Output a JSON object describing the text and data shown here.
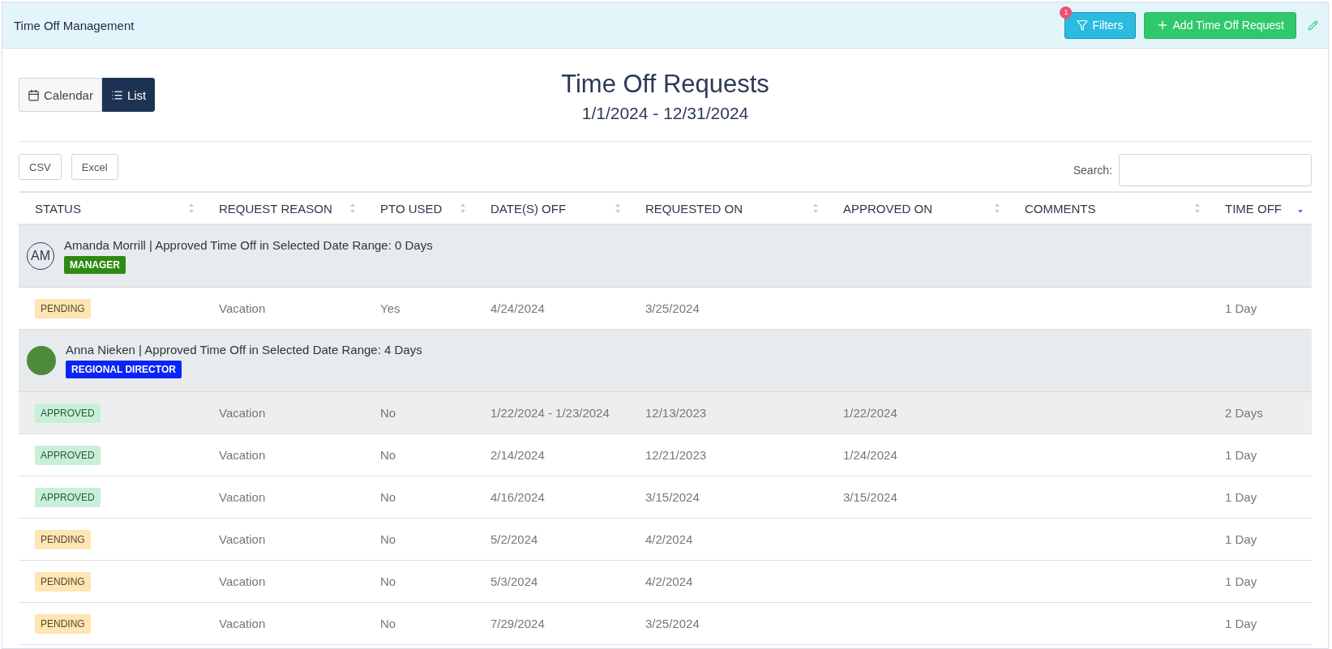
{
  "header": {
    "title": "Time Off Management",
    "filters_button": {
      "label": "Filters",
      "badge": "1"
    },
    "add_button": {
      "label": "Add Time Off Request"
    }
  },
  "view_toggle": [
    {
      "label": "Calendar",
      "kind": "calendar",
      "selected": false
    },
    {
      "label": "List",
      "kind": "list",
      "selected": true
    }
  ],
  "title": "Time Off Requests",
  "date_range": "1/1/2024 - 12/31/2024",
  "export_buttons": [
    "CSV",
    "Excel"
  ],
  "search": {
    "label": "Search:"
  },
  "table": {
    "columns": [
      {
        "label": "STATUS",
        "sorted": false
      },
      {
        "label": "REQUEST REASON",
        "sorted": false
      },
      {
        "label": "PTO USED",
        "sorted": false
      },
      {
        "label": "DATE(S) OFF",
        "sorted": false
      },
      {
        "label": "REQUESTED ON",
        "sorted": false
      },
      {
        "label": "APPROVED ON",
        "sorted": false
      },
      {
        "label": "COMMENTS",
        "sorted": false
      },
      {
        "label": "TIME OFF",
        "sorted": true
      }
    ],
    "groups": [
      {
        "employee": "Amanda Morrill | Approved Time Off in Selected Date Range: 0 Days",
        "avatar": {
          "kind": "initials",
          "text": "AM"
        },
        "role": {
          "label": "MANAGER",
          "color": "#2e8b12"
        },
        "rows": [
          {
            "status": {
              "label": "PENDING",
              "kind": "pending"
            },
            "cells": [
              "Vacation",
              "Yes",
              "4/24/2024",
              "3/25/2024",
              "",
              ""
            ],
            "time_off": "1 Day",
            "highlighted": false
          }
        ]
      },
      {
        "employee": "Anna Nieken | Approved Time Off in Selected Date Range: 4 Days",
        "avatar": {
          "kind": "photo"
        },
        "role": {
          "label": "REGIONAL DIRECTOR",
          "color": "#0a24f5"
        },
        "rows": [
          {
            "status": {
              "label": "APPROVED",
              "kind": "approved"
            },
            "cells": [
              "Vacation",
              "No",
              "1/22/2024 - 1/23/2024",
              "12/13/2023",
              "1/22/2024",
              ""
            ],
            "time_off": "2 Days",
            "highlighted": true
          },
          {
            "status": {
              "label": "APPROVED",
              "kind": "approved"
            },
            "cells": [
              "Vacation",
              "No",
              "2/14/2024",
              "12/21/2023",
              "1/24/2024",
              ""
            ],
            "time_off": "1 Day",
            "highlighted": false
          },
          {
            "status": {
              "label": "APPROVED",
              "kind": "approved"
            },
            "cells": [
              "Vacation",
              "No",
              "4/16/2024",
              "3/15/2024",
              "3/15/2024",
              ""
            ],
            "time_off": "1 Day",
            "highlighted": false
          },
          {
            "status": {
              "label": "PENDING",
              "kind": "pending"
            },
            "cells": [
              "Vacation",
              "No",
              "5/2/2024",
              "4/2/2024",
              "",
              ""
            ],
            "time_off": "1 Day",
            "highlighted": false
          },
          {
            "status": {
              "label": "PENDING",
              "kind": "pending"
            },
            "cells": [
              "Vacation",
              "No",
              "5/3/2024",
              "4/2/2024",
              "",
              ""
            ],
            "time_off": "1 Day",
            "highlighted": false
          },
          {
            "status": {
              "label": "PENDING",
              "kind": "pending"
            },
            "cells": [
              "Vacation",
              "No",
              "7/29/2024",
              "3/25/2024",
              "",
              ""
            ],
            "time_off": "1 Day",
            "highlighted": false
          }
        ]
      }
    ]
  }
}
